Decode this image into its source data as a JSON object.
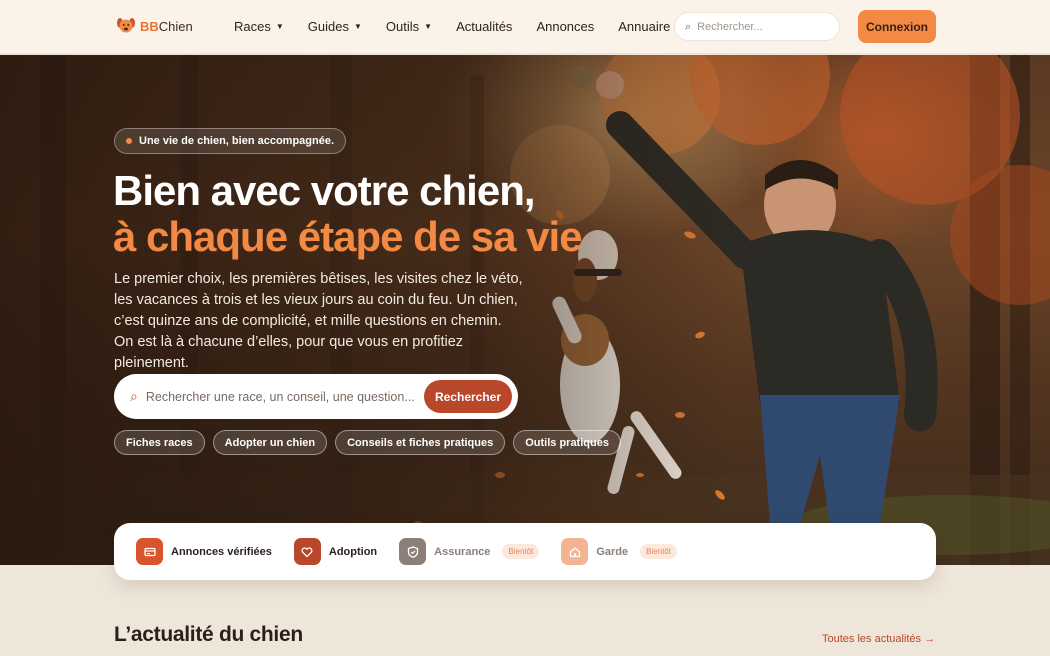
{
  "brand": {
    "prefix": "BB",
    "name": "Chien"
  },
  "nav": [
    {
      "label": "Races",
      "dropdown": true
    },
    {
      "label": "Guides",
      "dropdown": true
    },
    {
      "label": "Outils",
      "dropdown": true
    },
    {
      "label": "Actualités",
      "dropdown": false
    },
    {
      "label": "Annonces",
      "dropdown": false
    },
    {
      "label": "Annuaire",
      "dropdown": false
    }
  ],
  "header_search": {
    "placeholder": "Rechercher..."
  },
  "login_label": "Connexion",
  "hero": {
    "tagline": "Une vie de chien, bien accompagnée.",
    "title_line1": "Bien avec votre chien,",
    "title_line2": "à chaque étape de sa vie",
    "lead": "Le premier choix, les premières bêtises, les visites chez le véto, les vacances à trois et les vieux jours au coin du feu. Un chien, c’est quinze ans de complicité, et mille questions en chemin. On est là à chacune d’elles, pour que vous en profitiez pleinement.",
    "search_placeholder": "Rechercher une race, un conseil, une question...",
    "search_button": "Rechercher",
    "chips": [
      "Fiches races",
      "Adopter un chien",
      "Conseils et fiches pratiques",
      "Outils pratiques"
    ]
  },
  "features": [
    {
      "label": "Annonces vérifiées",
      "icon": "card-icon",
      "color": "#d9542d",
      "soon": ""
    },
    {
      "label": "Adoption",
      "icon": "heart-icon",
      "color": "#b9472a",
      "soon": ""
    },
    {
      "label": "Assurance",
      "icon": "shield-icon",
      "color": "#8b7f78",
      "soon": "Bientôt"
    },
    {
      "label": "Garde",
      "icon": "home-icon",
      "color": "#f4b393",
      "soon": "Bientôt"
    }
  ],
  "news": {
    "title": "L’actualité du chien",
    "link": "Toutes les actualités →"
  },
  "colors": {
    "accent": "#f28a45",
    "brand_dark": "#b9472a",
    "header_bg": "#fbf3ea",
    "page_bg": "#efe6da"
  }
}
